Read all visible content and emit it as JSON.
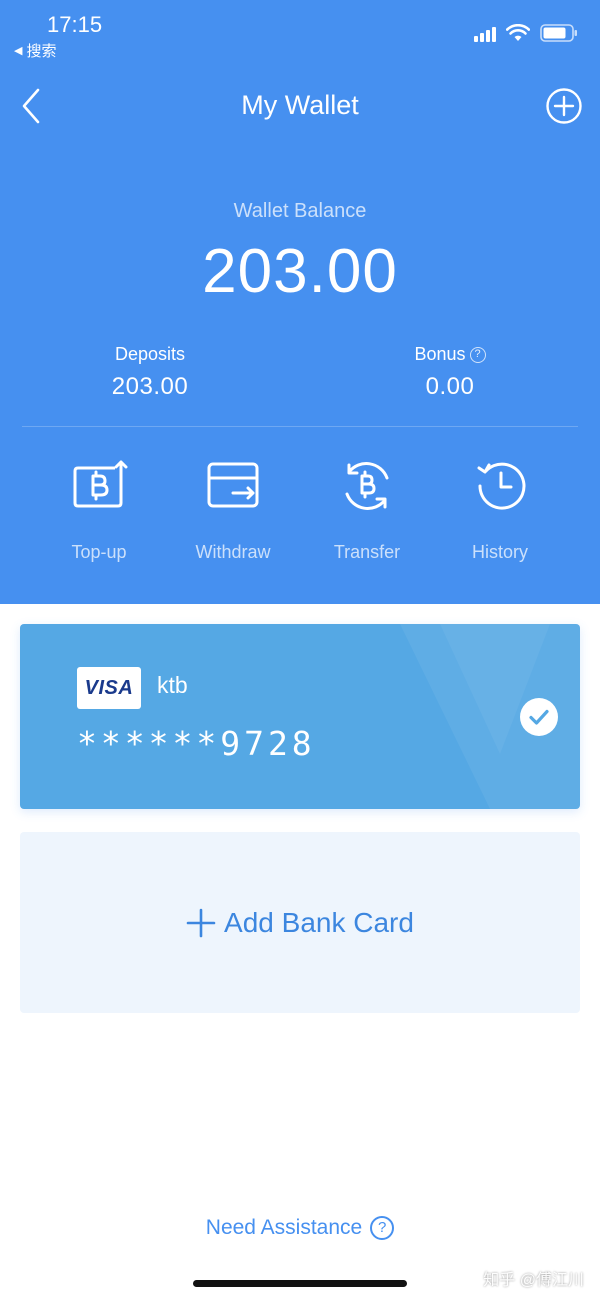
{
  "status_bar": {
    "time": "17:15",
    "back_label": "搜索"
  },
  "nav": {
    "title": "My Wallet"
  },
  "balance": {
    "label": "Wallet Balance",
    "value": "203.00"
  },
  "stats": {
    "deposits_label": "Deposits",
    "deposits_value": "203.00",
    "bonus_label": "Bonus",
    "bonus_value": "0.00",
    "help_glyph": "?"
  },
  "actions": [
    {
      "label": "Top-up",
      "icon": "bitcoin-up-icon"
    },
    {
      "label": "Withdraw",
      "icon": "wallet-withdraw-icon"
    },
    {
      "label": "Transfer",
      "icon": "bitcoin-transfer-icon"
    },
    {
      "label": "History",
      "icon": "clock-icon"
    }
  ],
  "card": {
    "brand": "VISA",
    "bank": "ktb",
    "number": "******9728",
    "selected": true
  },
  "add_card": {
    "label": "Add Bank Card"
  },
  "footer": {
    "assist_label": "Need Assistance",
    "help_glyph": "?",
    "watermark": "知乎 @傅江川"
  },
  "colors": {
    "primary": "#4690f0",
    "card": "#55a8e4",
    "add_card_bg": "#eef5fd"
  }
}
